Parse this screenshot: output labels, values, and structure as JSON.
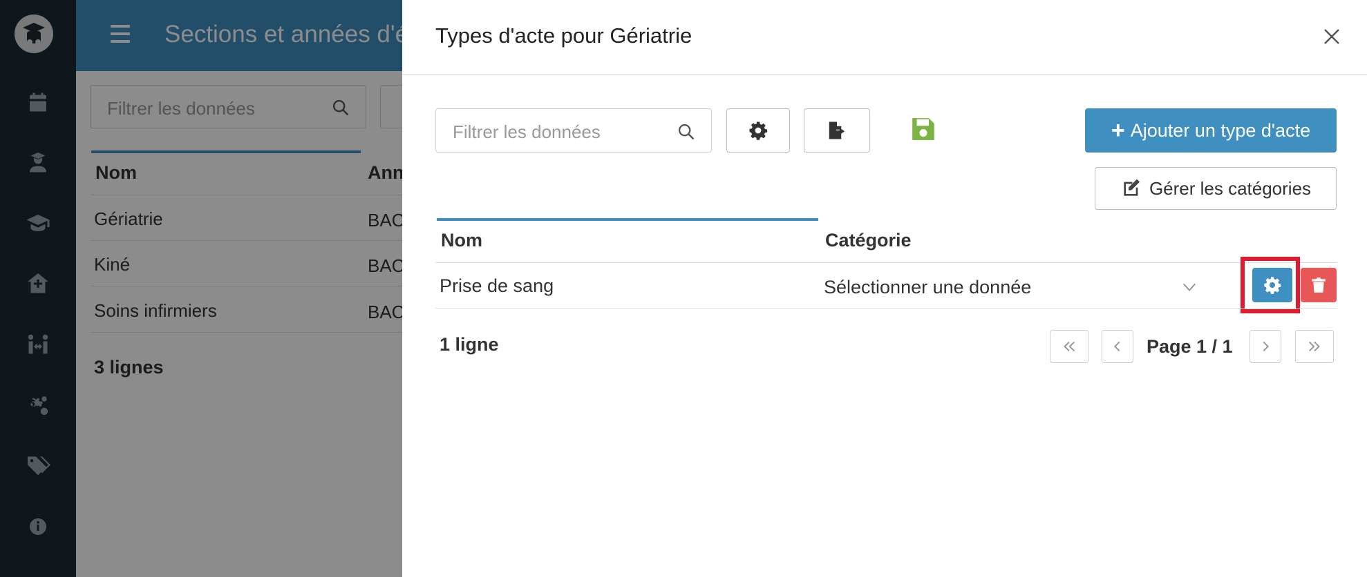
{
  "sidebar": {
    "logo_icon": "graduation-logo-icon",
    "items": [
      {
        "icon": "calendar-icon"
      },
      {
        "icon": "student-icon"
      },
      {
        "icon": "graduation-cap-icon"
      },
      {
        "icon": "hospital-icon"
      },
      {
        "icon": "users-exchange-icon"
      },
      {
        "icon": "cogs-icon"
      },
      {
        "icon": "tags-icon"
      },
      {
        "icon": "info-icon"
      }
    ]
  },
  "background": {
    "header_title": "Sections et années d'é",
    "search_placeholder": "Filtrer les données",
    "columns": [
      "Nom",
      "Anné"
    ],
    "rows": [
      {
        "name": "Gériatrie",
        "year": "BAC"
      },
      {
        "name": "Kiné",
        "year": "BAC"
      },
      {
        "name": "Soins infirmiers",
        "year": "BAC"
      }
    ],
    "row_count": "3 lignes"
  },
  "panel": {
    "title": "Types d'acte pour Gériatrie",
    "search_placeholder": "Filtrer les données",
    "add_button": "Ajouter un type d'acte",
    "categories_button": "Gérer les catégories",
    "columns": {
      "name": "Nom",
      "category": "Catégorie"
    },
    "rows": [
      {
        "name": "Prise de sang",
        "category": "Sélectionner une donnée"
      }
    ],
    "row_count": "1 ligne",
    "pagination": "Page 1 / 1"
  },
  "colors": {
    "primary": "#3f8fc1",
    "sidebar": "#1c2a33",
    "danger": "#e85757",
    "highlight": "#e01b2f",
    "save": "#7cb342"
  }
}
